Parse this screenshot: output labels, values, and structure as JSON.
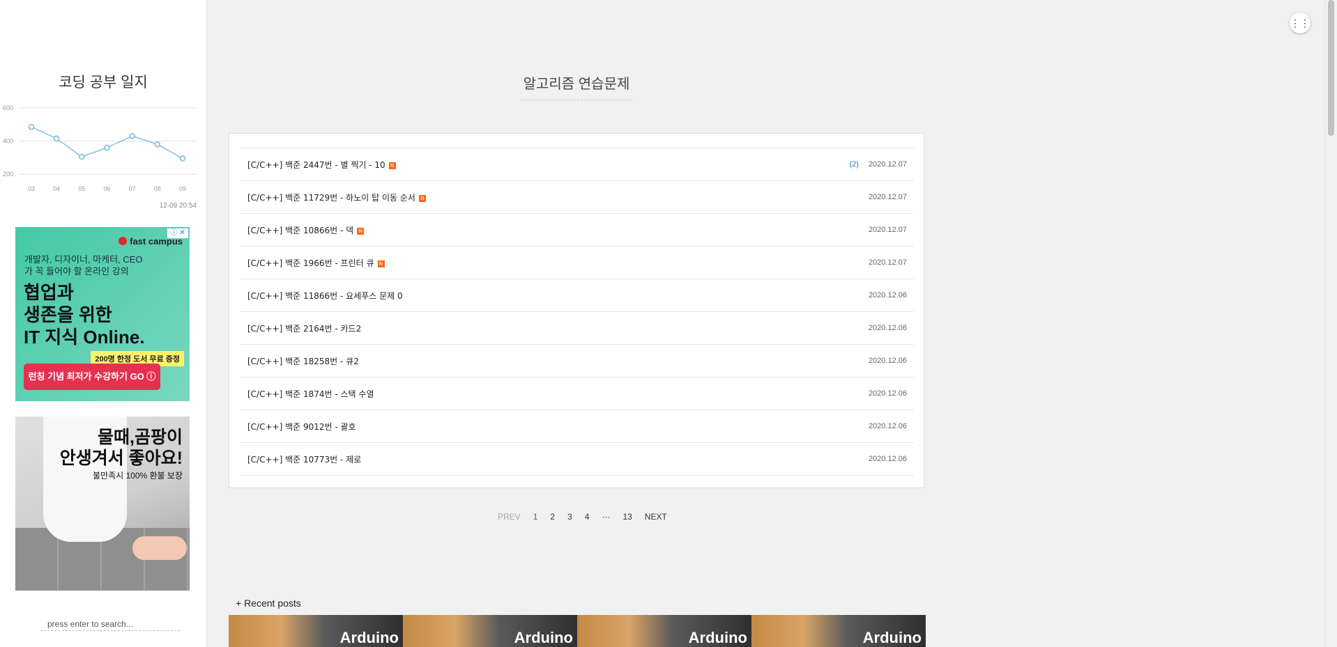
{
  "sidebar": {
    "blog_title": "코딩 공부 일지",
    "search_placeholder": "press enter to search...",
    "chart_stamp": "12-09 20:54"
  },
  "chart_data": {
    "type": "line",
    "categories": [
      "03",
      "04",
      "05",
      "06",
      "07",
      "08",
      "09"
    ],
    "values": [
      485,
      415,
      305,
      360,
      430,
      380,
      295
    ],
    "yticks": [
      600,
      400,
      200
    ],
    "ylim": [
      180,
      620
    ],
    "colors": {
      "line": "#72b8dd",
      "grid": "#e4e4e4"
    }
  },
  "ads": {
    "ad1": {
      "brand": "fast campus",
      "sub": "개발자, 디자이너, 마케터, CEO가 꼭 들어야 할 온라인 강의",
      "headline1": "협업과",
      "headline2": "생존을 위한",
      "headline3": "IT 지식 Online.",
      "promo": "200명 한정 도서 무료 증정",
      "cta": "런칭 기념 최저가 수강하기 GO ⓘ"
    },
    "ad2": {
      "line1": "물때,곰팡이",
      "line2": "안생겨서 좋아요!",
      "line3": "불만족시 100% 환불 보장"
    }
  },
  "main": {
    "category_title": "알고리즘 연습문제",
    "menu_icon": "⋮⋮",
    "posts": [
      {
        "title": "[C/C++] 백준 2447번 - 별 찍기 - 10",
        "new": "N",
        "comments": "(2)",
        "date": "2020.12.07"
      },
      {
        "title": "[C/C++] 백준 11729번 - 하노이 탑 이동 순서",
        "new": "N",
        "comments": "",
        "date": "2020.12.07"
      },
      {
        "title": "[C/C++] 백준 10866번 - 덱",
        "new": "N",
        "comments": "",
        "date": "2020.12.07"
      },
      {
        "title": "[C/C++] 백준 1966번 - 프린터 큐",
        "new": "N",
        "comments": "",
        "date": "2020.12.07"
      },
      {
        "title": "[C/C++] 백준 11866번 - 요세푸스 문제 0",
        "new": "",
        "comments": "",
        "date": "2020.12.06"
      },
      {
        "title": "[C/C++] 백준 2164번 - 카드2",
        "new": "",
        "comments": "",
        "date": "2020.12.06"
      },
      {
        "title": "[C/C++] 백준 18258번 - 큐2",
        "new": "",
        "comments": "",
        "date": "2020.12.06"
      },
      {
        "title": "[C/C++] 백준 1874번 - 스택 수열",
        "new": "",
        "comments": "",
        "date": "2020.12.06"
      },
      {
        "title": "[C/C++] 백준 9012번 - 괄호",
        "new": "",
        "comments": "",
        "date": "2020.12.06"
      },
      {
        "title": "[C/C++] 백준 10773번 - 제로",
        "new": "",
        "comments": "",
        "date": "2020.12.06"
      }
    ],
    "pagination": {
      "prev": "PREV",
      "pages": [
        "1",
        "2",
        "3",
        "4",
        "···",
        "13"
      ],
      "current": "1",
      "next": "NEXT"
    },
    "recent_heading": "+ Recent posts",
    "recent_thumbs": [
      "Arduino",
      "Arduino",
      "Arduino",
      "Arduino"
    ]
  }
}
